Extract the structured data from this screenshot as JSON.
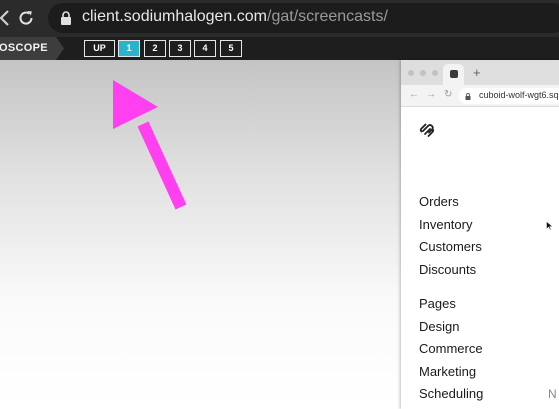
{
  "browser": {
    "url_host": "client.sodiumhalogen.com",
    "url_path": "/gat/screencasts/",
    "icons": [
      "back-icon",
      "reload-icon",
      "lock-icon"
    ]
  },
  "toolbar": {
    "brand": "OSCOPE",
    "buttons": [
      {
        "label": "UP",
        "active": false
      },
      {
        "label": "1",
        "active": true
      },
      {
        "label": "2",
        "active": false
      },
      {
        "label": "3",
        "active": false
      },
      {
        "label": "4",
        "active": false
      },
      {
        "label": "5",
        "active": false
      }
    ],
    "active_color": "#2bb3cc"
  },
  "annotation": {
    "color": "#ff3ff0",
    "icon": "arrow-icon"
  },
  "inner_browser": {
    "new_tab": "+",
    "address": "cuboid-wolf-wgt6.sq",
    "logo_icon": "squarespace-logo-icon",
    "menu_group1": [
      "Orders",
      "Inventory",
      "Customers",
      "Discounts"
    ],
    "menu_group2": [
      "Pages",
      "Design",
      "Commerce",
      "Marketing",
      "Scheduling"
    ],
    "clipped_text": "N"
  }
}
